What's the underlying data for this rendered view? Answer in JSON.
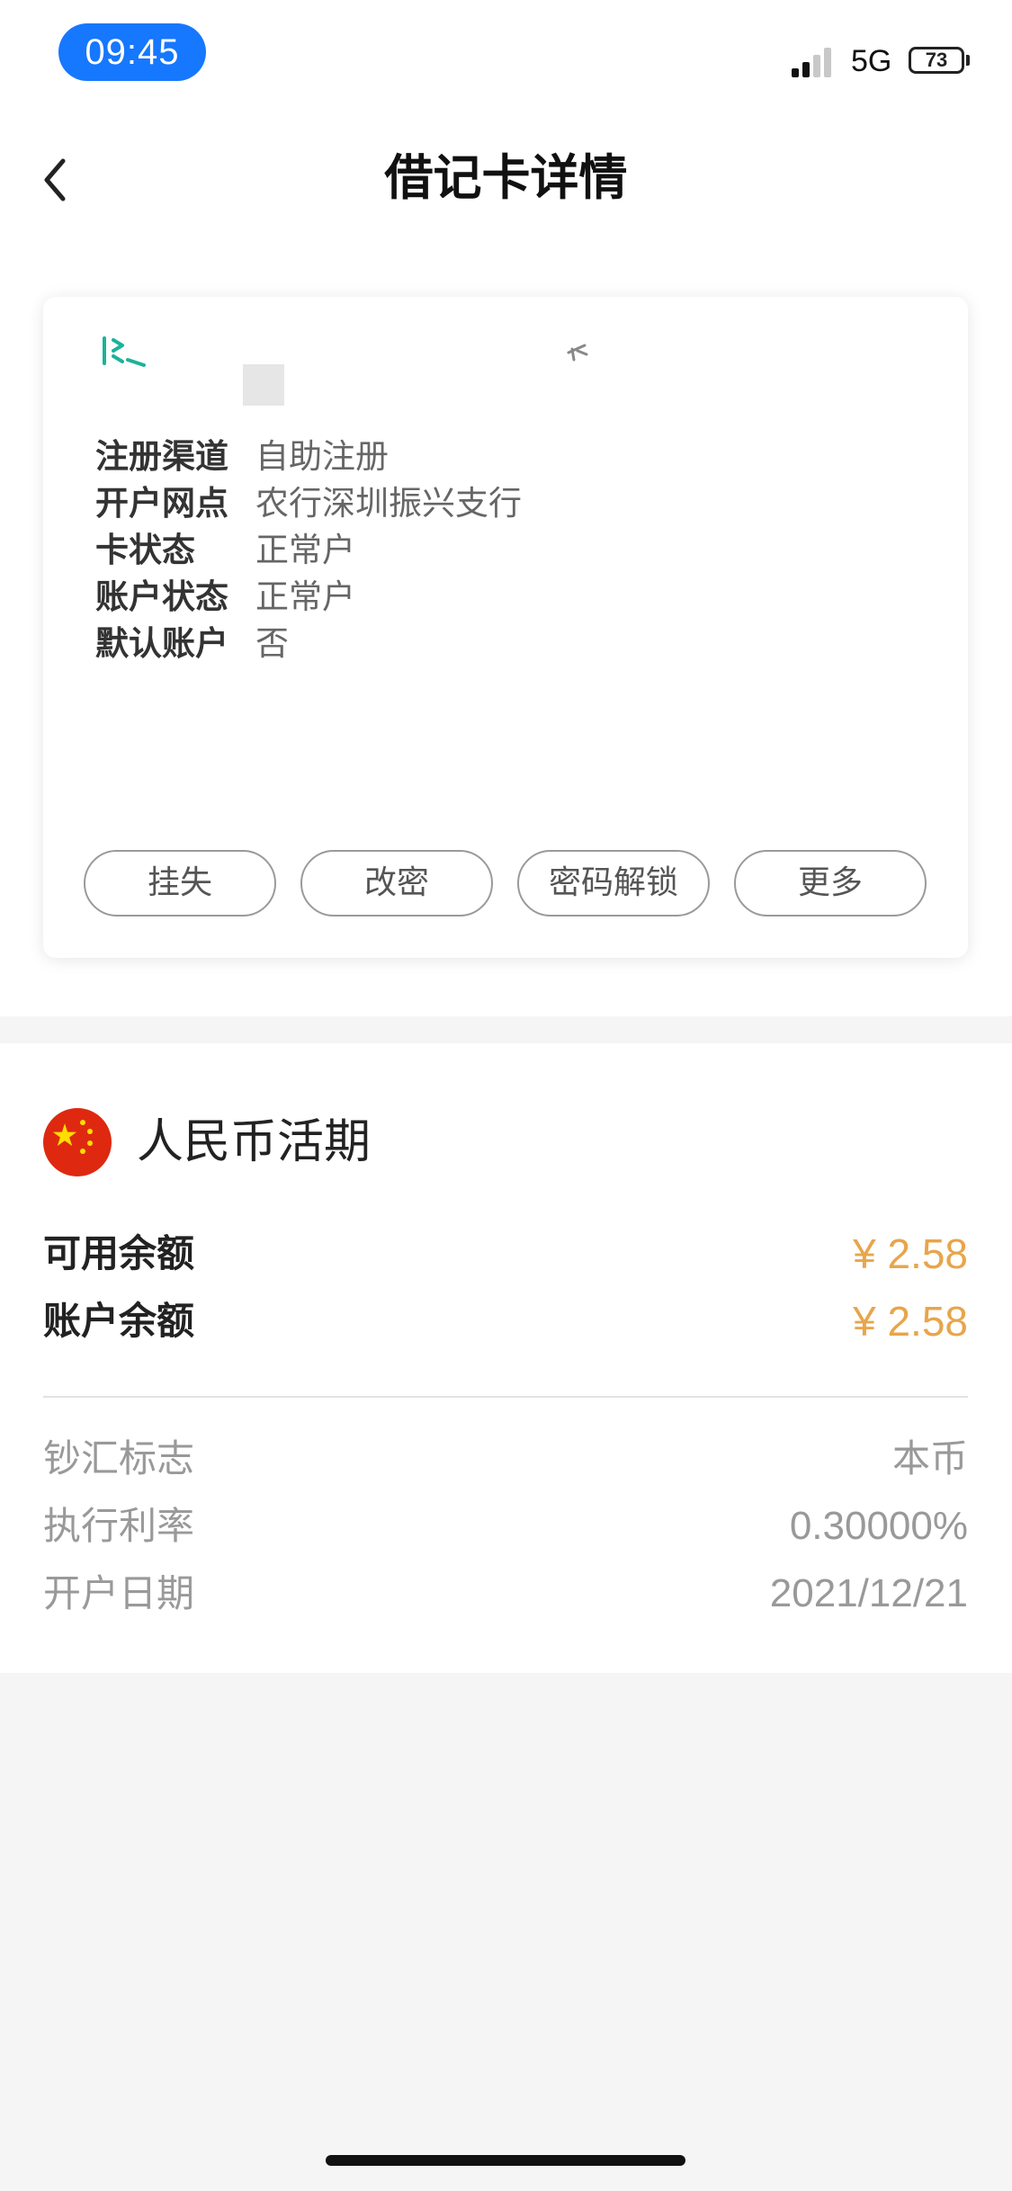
{
  "status_bar": {
    "time": "09:45",
    "network": "5G",
    "battery": "73",
    "accent_color": "#1677ff"
  },
  "nav": {
    "back_icon": "chevron-left-icon",
    "title": "借记卡详情"
  },
  "card": {
    "info": [
      {
        "label": "注册渠道",
        "value": "自助注册"
      },
      {
        "label": "开户网点",
        "value": "农行深圳振兴支行"
      },
      {
        "label": "卡状态",
        "value": "正常户"
      },
      {
        "label": "账户状态",
        "value": "正常户"
      },
      {
        "label": "默认账户",
        "value": "否"
      }
    ],
    "actions": [
      "挂失",
      "改密",
      "密码解锁",
      "更多"
    ]
  },
  "account": {
    "flag_icon": "china-flag-icon",
    "currency_title": "人民币活期",
    "balances": [
      {
        "label": "可用余额",
        "value": "¥ 2.58"
      },
      {
        "label": "账户余额",
        "value": "¥ 2.58"
      }
    ],
    "details": [
      {
        "label": "钞汇标志",
        "value": "本币"
      },
      {
        "label": "执行利率",
        "value": "0.30000%"
      },
      {
        "label": "开户日期",
        "value": "2021/12/21"
      }
    ],
    "amount_color": "#e8a54b"
  }
}
